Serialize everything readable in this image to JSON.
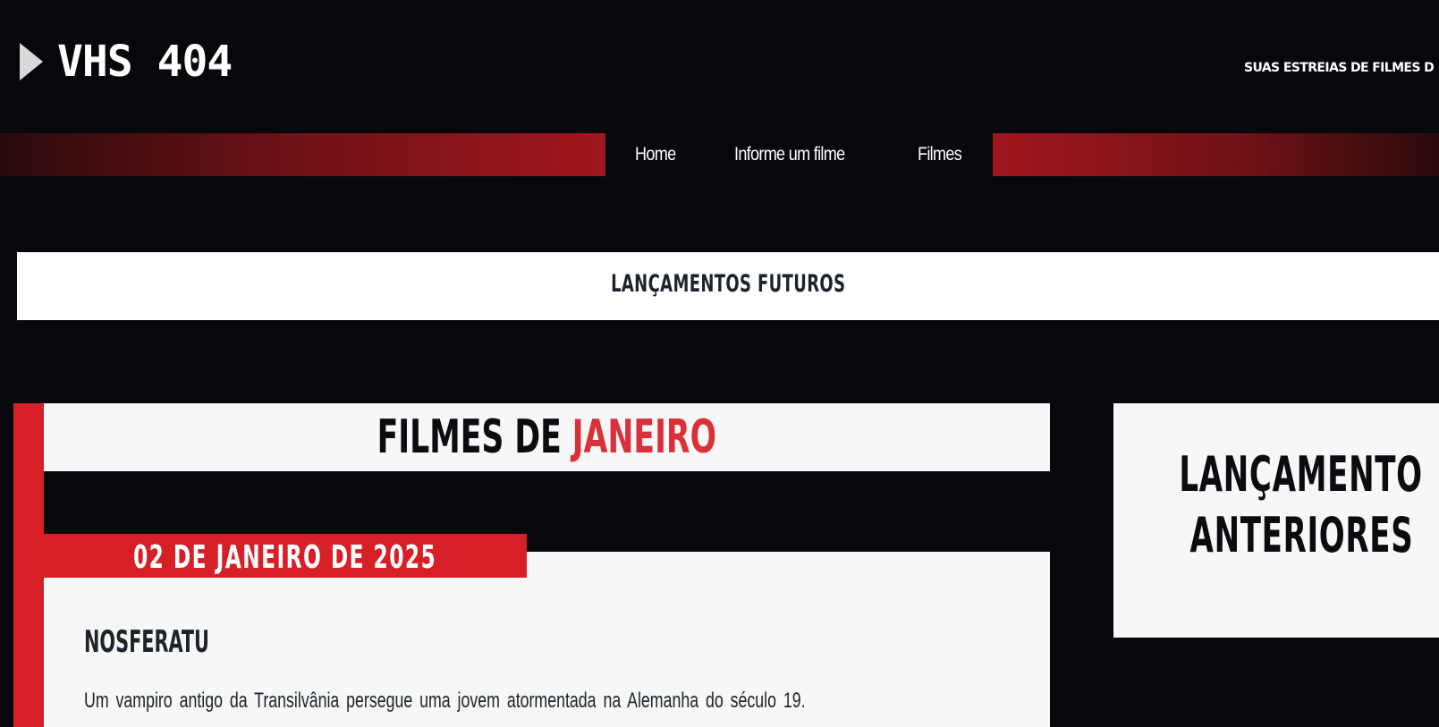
{
  "header": {
    "logo_text": "VHS 404",
    "logo_icon": "play-icon",
    "tagline": "SUAS ESTREIAS DE FILMES D"
  },
  "nav": {
    "items": [
      {
        "label": "Home"
      },
      {
        "label": "Informe um filme"
      },
      {
        "label": "Filmes"
      }
    ]
  },
  "section": {
    "title": "LANÇAMENTOS FUTUROS"
  },
  "month": {
    "prefix": "FILMES DE",
    "name": "JANEIRO"
  },
  "release": {
    "date": "02 DE JANEIRO DE 2025",
    "title": "NOSFERATU",
    "description": "Um vampiro antigo da Transilvânia persegue uma jovem atormentada na Alemanha do século 19."
  },
  "sidebar": {
    "title_line1": "LANÇAMENTO",
    "title_line2": "ANTERIORES"
  },
  "colors": {
    "background": "#07080c",
    "accent_red": "#d61f27",
    "month_red": "#d9303a",
    "card_bg": "#f7f7f7",
    "dark_text": "#1d232b"
  }
}
